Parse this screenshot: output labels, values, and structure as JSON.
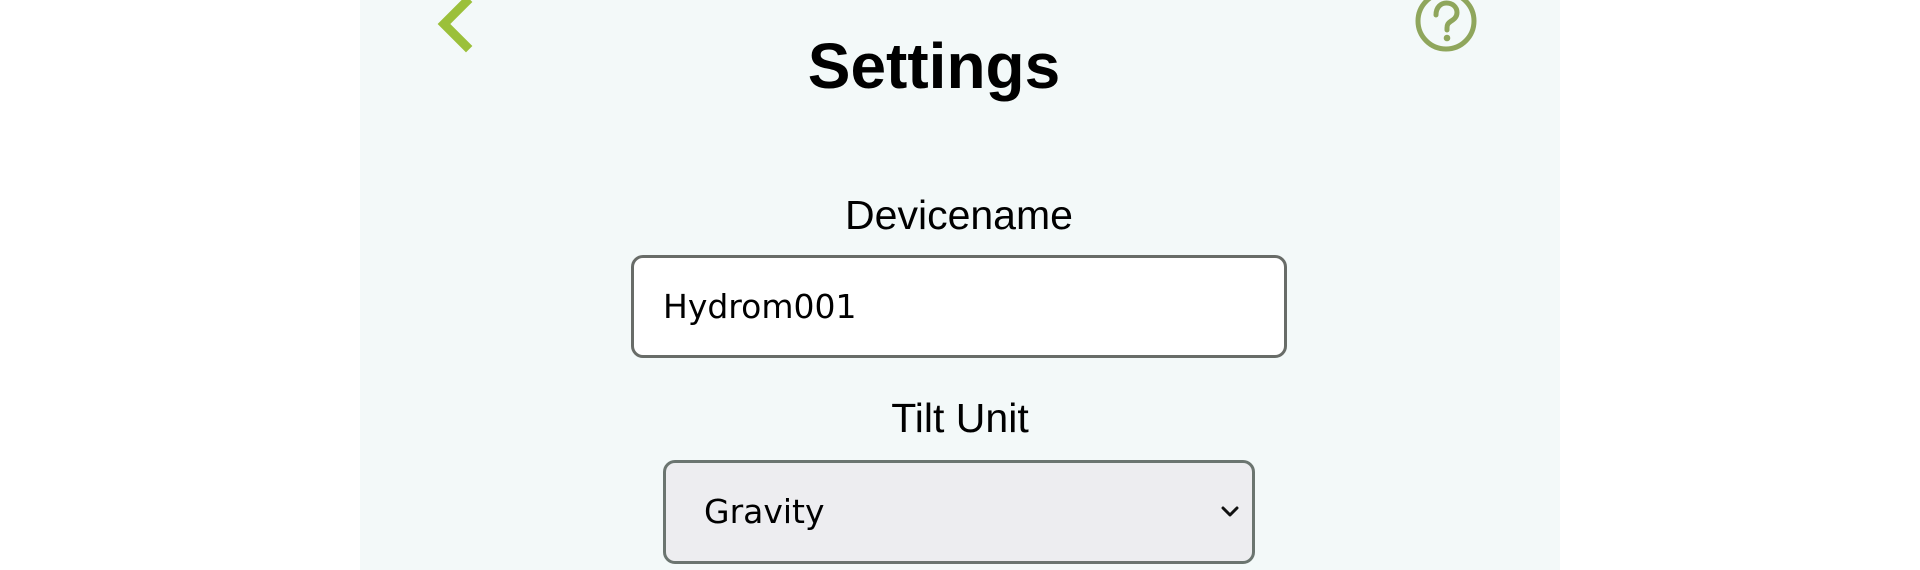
{
  "header": {
    "title": "Settings",
    "back_icon": "chevron-left-icon",
    "help_icon": "help-circle-icon",
    "accent_color": "#9bc03a",
    "help_color": "#8fa65c"
  },
  "form": {
    "device_name": {
      "label": "Devicename",
      "value": "Hydrom001"
    },
    "tilt_unit": {
      "label": "Tilt Unit",
      "selected": "Gravity",
      "chevron_icon": "chevron-down-icon"
    }
  },
  "colors": {
    "panel_background": "#f3f9f9",
    "page_background": "#ffffff"
  }
}
